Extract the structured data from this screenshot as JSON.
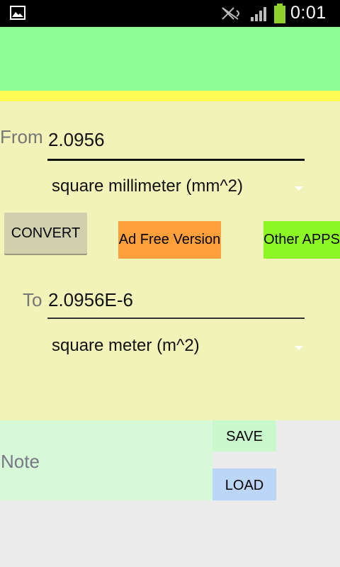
{
  "status_bar": {
    "time": "0:01",
    "icons": [
      "gallery-icon",
      "mute-icon",
      "signal-icon",
      "battery-icon"
    ]
  },
  "converter": {
    "from_label": "From",
    "from_value": "2.0956",
    "from_unit": "square millimeter (mm^2)",
    "to_label": "To",
    "to_value": "2.0956E-6",
    "to_unit": "square meter (m^2)"
  },
  "buttons": {
    "convert": "CONVERT",
    "ad_free": "Ad Free Version",
    "other_apps": "Other APPS",
    "save": "SAVE",
    "load": "LOAD"
  },
  "note": {
    "placeholder": "Note"
  },
  "colors": {
    "banner": "#8efd94",
    "strip": "#fffd55",
    "panel": "#f1f3b9",
    "convert_button": "#d0d0ad",
    "ad_free_button": "#ffa03a",
    "other_apps_button": "#8bf826",
    "note_area": "#d7f9d7",
    "save_button": "#c8f8cc",
    "load_button": "#bcd6f8"
  }
}
